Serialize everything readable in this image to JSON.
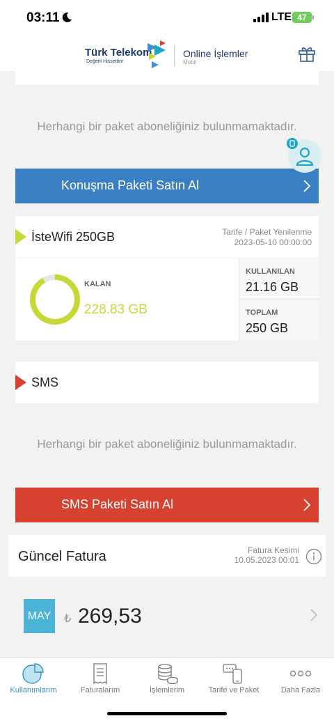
{
  "status_bar": {
    "time": "03:11",
    "network": "LTE",
    "battery": "47"
  },
  "header": {
    "brand": "Türk Telekom",
    "slogan": "Değerli Hissettirir",
    "online": "Online İşlemler",
    "online_sub": "Mobil"
  },
  "voice": {
    "empty_message": "Herhangi bir paket aboneliğiniz bulunmamaktadır.",
    "buy_label": "Konuşma Paketi Satın Al"
  },
  "data_package": {
    "title": "İsteWifi 250GB",
    "renew_label": "Tarife / Paket Yenilenme",
    "renew_date": "2023-05-10 00:00:00",
    "remaining_label": "KALAN",
    "remaining_value": "228.83 GB",
    "used_label": "KULLANILAN",
    "used_value": "21.16 GB",
    "total_label": "TOPLAM",
    "total_value": "250 GB",
    "remaining_fraction": 0.9154,
    "ring_color": "#c5d834"
  },
  "sms": {
    "title": "SMS",
    "empty_message": "Herhangi bir paket aboneliğiniz bulunmamaktadır.",
    "buy_label": "SMS Paketi Satın Al"
  },
  "invoice": {
    "title": "Güncel Fatura",
    "cut_label": "Fatura Kesimi",
    "cut_date": "10.05.2023 00:01",
    "month": "MAY",
    "currency": "₺",
    "amount": "269,53"
  },
  "tabs": [
    {
      "label": "Kullanımlarım",
      "icon": "pie-chart-icon",
      "active": true
    },
    {
      "label": "Faturalarım",
      "icon": "receipt-icon",
      "active": false
    },
    {
      "label": "İşlemlerim",
      "icon": "coins-icon",
      "active": false
    },
    {
      "label": "Tarife ve Paket",
      "icon": "phone-chat-icon",
      "active": false
    },
    {
      "label": "Daha Fazla",
      "icon": "more-dots-icon",
      "active": false
    }
  ],
  "colors": {
    "accent_blue": "#3a7fc4",
    "accent_red": "#d6422f",
    "lime": "#c5d834",
    "brand_navy": "#1b3a6b",
    "tab_active": "#2f94c4"
  }
}
